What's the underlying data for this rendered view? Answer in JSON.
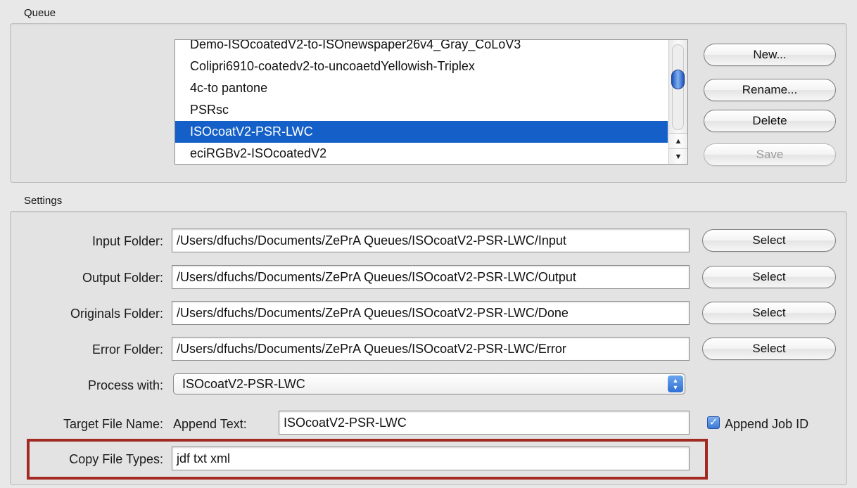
{
  "queue": {
    "section_label": "Queue",
    "items": [
      {
        "label": "Demo-ISOcoatedV2-to-ISOnewspaper26v4_Gray_CoLoV3",
        "selected": false
      },
      {
        "label": "Colipri6910-coatedv2-to-uncoaetdYellowish-Triplex",
        "selected": false
      },
      {
        "label": "4c-to pantone",
        "selected": false
      },
      {
        "label": "PSRsc",
        "selected": false
      },
      {
        "label": "ISOcoatV2-PSR-LWC",
        "selected": true
      },
      {
        "label": "eciRGBv2-ISOcoatedV2",
        "selected": false
      }
    ],
    "buttons": {
      "new": "New...",
      "rename": "Rename...",
      "delete": "Delete",
      "save": "Save"
    }
  },
  "settings": {
    "section_label": "Settings",
    "input_folder": {
      "label": "Input Folder:",
      "value": "/Users/dfuchs/Documents/ZePrA Queues/ISOcoatV2-PSR-LWC/Input",
      "button": "Select"
    },
    "output_folder": {
      "label": "Output Folder:",
      "value": "/Users/dfuchs/Documents/ZePrA Queues/ISOcoatV2-PSR-LWC/Output",
      "button": "Select"
    },
    "originals_folder": {
      "label": "Originals Folder:",
      "value": "/Users/dfuchs/Documents/ZePrA Queues/ISOcoatV2-PSR-LWC/Done",
      "button": "Select"
    },
    "error_folder": {
      "label": "Error Folder:",
      "value": "/Users/dfuchs/Documents/ZePrA Queues/ISOcoatV2-PSR-LWC/Error",
      "button": "Select"
    },
    "process_with": {
      "label": "Process with:",
      "value": "ISOcoatV2-PSR-LWC"
    },
    "target_file_name": {
      "label": "Target File Name:",
      "append_text_label": "Append Text:",
      "append_text_value": "ISOcoatV2-PSR-LWC",
      "append_job_id_label": "Append Job ID",
      "append_job_id_checked": true
    },
    "copy_file_types": {
      "label": "Copy File Types:",
      "value": "jdf  txt  xml"
    }
  },
  "colors": {
    "selection": "#1560c8",
    "highlight_border": "#a32a22"
  }
}
